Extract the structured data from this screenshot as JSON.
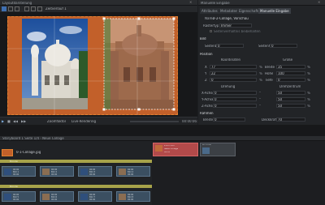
{
  "window": {
    "left_title": "Layoutdarstellung",
    "right_title": "Manuelle Eingabe"
  },
  "preview": {
    "toolbar_value": "Zeitverlauf   1",
    "zoom_label": "Zoomfaktor",
    "mode_label": "Live-Rendering",
    "timecode": "00:00:06:15"
  },
  "props": {
    "tabs": [
      "Attributes",
      "Metadaten",
      "Eigenschaften",
      "Manuelle Eingabe"
    ],
    "name_label": "Name",
    "name_value": "2-2-Collage, Vorschau",
    "format_label": "Rastertyp",
    "format_value": "Immer",
    "format_checkbox": "Seitenverhältnis beibehalten",
    "section_size": "Bild",
    "size_w_label": "Seitenbrei",
    "size_w_value": "0",
    "size_h_label": "Seitenhöh",
    "size_h_value": "0",
    "section_position": "Position",
    "col_coord": "Koordinaten",
    "col_size": "Größe",
    "x_label": "X",
    "x_value": "77",
    "y_label": "Y",
    "y_value": "22",
    "z_label": "Z",
    "z_value": "0",
    "width_label": "Breite",
    "width_value": "35",
    "height_label": "Höhe",
    "height_value": "100",
    "depth_label": "Tiefe",
    "depth_value": "0",
    "col_rotate": "Drehung",
    "col_anchor": "Drehzentrum",
    "rx_label": "X-Achse",
    "rx_value": "0",
    "ry_label": "Y-Achse",
    "ry_value": "0",
    "rz_label": "Z-Achse",
    "rz_value": "0",
    "ax_value": "50",
    "ay_value": "50",
    "az_value": "50",
    "section_border": "Rahmen",
    "border_label": "Breite",
    "border_value": "0",
    "opacity_label": "Deckkraft",
    "opacity_value": "70",
    "unit_pct": "%",
    "unit_deg": "°"
  },
  "timeline": {
    "header": "Storyboard 1 Seite 1/4 - Neue Collage",
    "top_clip_name": "0-1-Collage.jpg",
    "track1_label": "Bündel",
    "track2_label": "Bündel",
    "selected_clip_title": "2-2-1 Coll",
    "selected_clip_sub": "Neue Collage",
    "selected_clip_time": "00:00",
    "right_clip_title": "Pic Inmo",
    "clips": [
      {
        "t1": "00:00",
        "t2": "Bild 1",
        "t3": "00:00"
      },
      {
        "t1": "00:00",
        "t2": "Bild 2",
        "t3": "00:00"
      },
      {
        "t1": "00:00",
        "t2": "Bild 3",
        "t3": "00:00"
      },
      {
        "t1": "00:00",
        "t2": "Bild 4",
        "t3": "00:00"
      }
    ],
    "clips2": [
      {
        "t1": "00:00",
        "t2": "Bild 5",
        "t3": "00:00"
      },
      {
        "t1": "00:00",
        "t2": "Bild 6",
        "t3": "00:00"
      },
      {
        "t1": "00:00",
        "t2": "Bild 7",
        "t3": "00:00"
      },
      {
        "t1": "00:00",
        "t2": "Bild 8",
        "t3": "00:00"
      }
    ]
  },
  "colors": {
    "frame": "#c2602a",
    "accent": "#e08030",
    "track": "#a7a34a",
    "selected_clip": "#b24a4a"
  }
}
